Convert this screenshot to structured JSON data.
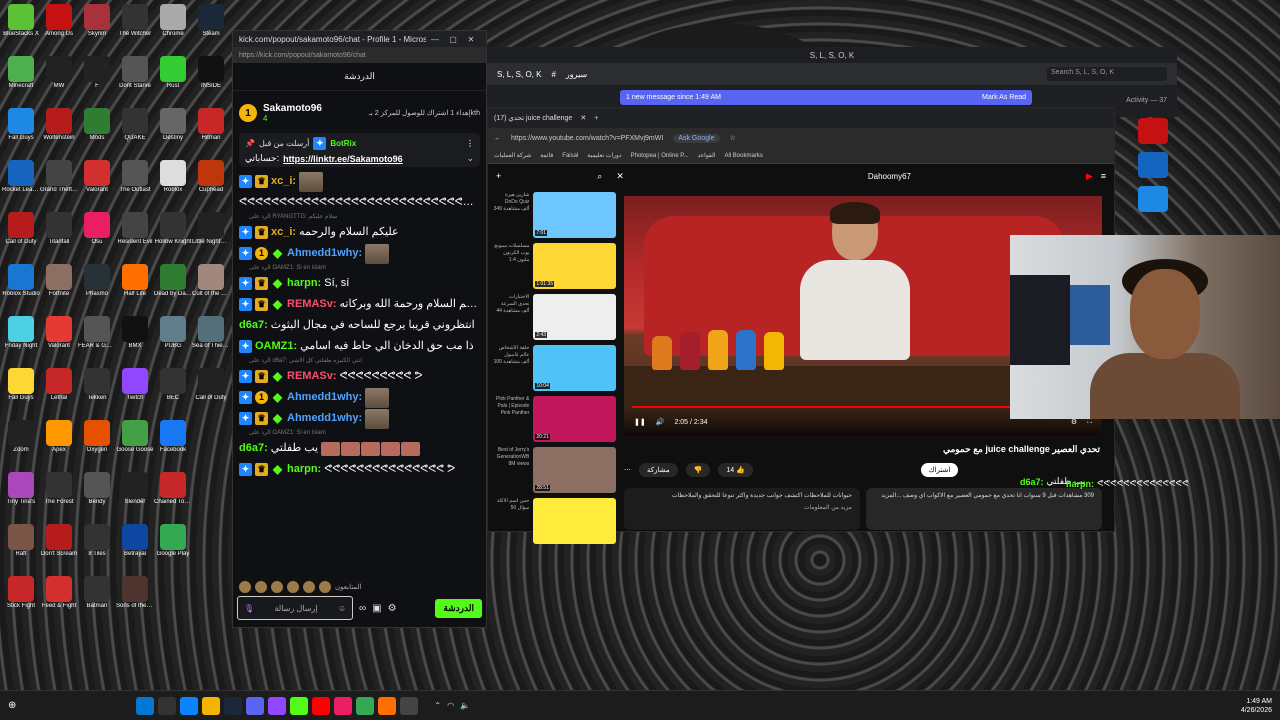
{
  "desktop": {
    "icons": [
      {
        "label": "BlueStacks X",
        "color": "#5bc236"
      },
      {
        "label": "Among Us",
        "color": "#c51111"
      },
      {
        "label": "Skyrim",
        "color": "#a8323c"
      },
      {
        "label": "The Witcher",
        "color": "#333"
      },
      {
        "label": "Chrome",
        "color": "#aaa"
      },
      {
        "label": "Steam",
        "color": "#1b2838"
      },
      {
        "label": "Minecraft",
        "color": "#4caf50"
      },
      {
        "label": "MW",
        "color": "#222"
      },
      {
        "label": "F",
        "color": "#222"
      },
      {
        "label": "Dont Starve",
        "color": "#555"
      },
      {
        "label": "Rust",
        "color": "#3c3"
      },
      {
        "label": "INSIDE",
        "color": "#111"
      },
      {
        "label": "Fall Guys",
        "color": "#1e88e5"
      },
      {
        "label": "Wolfenstein",
        "color": "#b71c1c"
      },
      {
        "label": "Mods",
        "color": "#2e7d32"
      },
      {
        "label": "QUAKE",
        "color": "#333"
      },
      {
        "label": "Destiny",
        "color": "#666"
      },
      {
        "label": "Hitman",
        "color": "#c62828"
      },
      {
        "label": "Rocket League",
        "color": "#1565c0"
      },
      {
        "label": "Grand Theft Auto",
        "color": "#444"
      },
      {
        "label": "Valorant",
        "color": "#d32f2f"
      },
      {
        "label": "The Outlast",
        "color": "#555"
      },
      {
        "label": "Roblox",
        "color": "#ddd"
      },
      {
        "label": "Cuphead",
        "color": "#bf360c"
      },
      {
        "label": "Call of Duty",
        "color": "#b71c1c"
      },
      {
        "label": "Titanfall",
        "color": "#333"
      },
      {
        "label": "Osu",
        "color": "#e91e63"
      },
      {
        "label": "Resident Evil",
        "color": "#444"
      },
      {
        "label": "Hollow Knight",
        "color": "#333"
      },
      {
        "label": "Little Nightmares",
        "color": "#222"
      },
      {
        "label": "Roblox Studio",
        "color": "#1976d2"
      },
      {
        "label": "Fortnite",
        "color": "#8d6e63"
      },
      {
        "label": "Phasmo",
        "color": "#263238"
      },
      {
        "label": "Half Life",
        "color": "#ff6f00"
      },
      {
        "label": "Dead by Daylight",
        "color": "#2e7d32"
      },
      {
        "label": "Cult of the Lamb",
        "color": "#a1887f"
      },
      {
        "label": "Friday Night",
        "color": "#4dd0e1"
      },
      {
        "label": "Valorant",
        "color": "#e53935"
      },
      {
        "label": "FEAR & GREED",
        "color": "#555"
      },
      {
        "label": "BMX",
        "color": "#111"
      },
      {
        "label": "PUBG",
        "color": "#607d8b"
      },
      {
        "label": "Sea of Thieves",
        "color": "#546e7a"
      },
      {
        "label": "Fall Guys",
        "color": "#fdd835"
      },
      {
        "label": "Lethal",
        "color": "#c62828"
      },
      {
        "label": "Tekken",
        "color": "#333"
      },
      {
        "label": "Twitch",
        "color": "#9146ff"
      },
      {
        "label": "BEC",
        "color": "#333"
      },
      {
        "label": "Call of Duty",
        "color": "#222"
      },
      {
        "label": "Zoom",
        "color": "#222"
      },
      {
        "label": "Apex",
        "color": "#ff9800"
      },
      {
        "label": "Oxygen",
        "color": "#e65100"
      },
      {
        "label": "Goose Goose",
        "color": "#43a047"
      },
      {
        "label": "Facebook",
        "color": "#1877f2"
      },
      {
        "label": "",
        "color": "transparent"
      },
      {
        "label": "Tiny Tina's",
        "color": "#ab47bc"
      },
      {
        "label": "The Forest",
        "color": "#333"
      },
      {
        "label": "Bendy",
        "color": "#555"
      },
      {
        "label": "Slender",
        "color": "#222"
      },
      {
        "label": "Chained Together",
        "color": "#c62828"
      },
      {
        "label": "",
        "color": "transparent"
      },
      {
        "label": "Raft",
        "color": "#795548"
      },
      {
        "label": "Don't Scream",
        "color": "#b71c1c"
      },
      {
        "label": "8 Tiles",
        "color": "#333"
      },
      {
        "label": "Betrayal",
        "color": "#0d47a1"
      },
      {
        "label": "Google Play",
        "color": "#34a853"
      },
      {
        "label": "",
        "color": "transparent"
      },
      {
        "label": "Stick Fight",
        "color": "#c62828"
      },
      {
        "label": "Feed & Fight",
        "color": "#d32f2f"
      },
      {
        "label": "Batman",
        "color": "#333"
      },
      {
        "label": "Sons of the Forest",
        "color": "#4e342e"
      },
      {
        "label": "",
        "color": "transparent"
      },
      {
        "label": "",
        "color": "transparent"
      }
    ]
  },
  "chat_window": {
    "title": "kick.com/popout/sakamoto96/chat - Profile 1 - Micros...",
    "url": "https://kick.com/popout/sakamoto96/chat",
    "header": "الدردشة",
    "pinned_user": "Sakamoto96",
    "pinned_medal": "1",
    "pinned_count": "4",
    "pinned_note": "إهداء 1 اشتراك للوصول للمركز 2 بـkth",
    "botrix": {
      "pre": "أرسلت من قبل",
      "name": "BotRix",
      "label": "حساباتي:",
      "link": "https://linktr.ee/Sakamoto96"
    },
    "messages": [
      {
        "reply": "",
        "user": "xc_i:",
        "color": "#e4ab22",
        "badges": [
          "pin",
          "crown"
        ],
        "text": ""
      },
      {
        "reply": "",
        "user": "",
        "color": "#fff",
        "badges": [],
        "text": "ᕙᕙᕙᕙᕙᕙᕙᕙᕙᕙᕙᕙᕙᕙᕙᕙᕙᕙᕙᕙᕙᕙᕙᕙᕙᕙᕙᕙᕙᕙᕙᕙᕙ ᕗ"
      },
      {
        "reply": "الرد على RYANGTTG: سلام عليكم",
        "user": "xc_i:",
        "color": "#e4ab22",
        "badges": [
          "pin",
          "crown"
        ],
        "text": "عليكم السلام والرحمه"
      },
      {
        "reply": "",
        "user": "Ahmedd1why:",
        "color": "#4fa3ff",
        "badges": [
          "pin",
          "one",
          "diamond"
        ],
        "text": ""
      },
      {
        "reply": "الرد على OAMZ1: Si en islam",
        "user": "harpn:",
        "color": "#53fc18",
        "badges": [
          "pin",
          "crown",
          "diamond"
        ],
        "text": "Sí, sí"
      },
      {
        "reply": "",
        "user": "REMASv:",
        "color": "#ff4d6d",
        "badges": [
          "pin",
          "crown",
          "diamond"
        ],
        "text": "وعليكم السلام ورحمة الله وبركاته"
      },
      {
        "reply": "",
        "user": "d6a7:",
        "color": "#53fc18",
        "badges": [],
        "text": "انتظروني قريبا يرجع للساحه في مجال البثوث"
      },
      {
        "reply": "",
        "user": "OAMZ1:",
        "color": "#53fc18",
        "badges": [
          "pin"
        ],
        "text": "ذا مب حق الدخان الي حاط فيه اسامي"
      },
      {
        "reply": "الرد على d6a7: انتي الكبيره طفلتي كل الاشي",
        "user": "REMASv:",
        "color": "#ff4d6d",
        "badges": [
          "pin",
          "crown",
          "diamond"
        ],
        "text": "ᕙᕙᕙᕙᕙᕙᕙᕙᕙ ᕗ"
      },
      {
        "reply": "",
        "user": "Ahmedd1why:",
        "color": "#4fa3ff",
        "badges": [
          "pin",
          "one",
          "diamond"
        ],
        "text": ""
      },
      {
        "reply": "",
        "user": "Ahmedd1why:",
        "color": "#4fa3ff",
        "badges": [
          "pin",
          "crown",
          "diamond"
        ],
        "text": ""
      },
      {
        "reply": "الرد على OAMZ1: Si en islam",
        "user": "d6a7:",
        "color": "#53fc18",
        "badges": [],
        "text": "يب طفلتي"
      },
      {
        "reply": "",
        "user": "harpn:",
        "color": "#53fc18",
        "badges": [
          "pin",
          "crown",
          "diamond"
        ],
        "text": "ᕙᕙᕙᕙᕙᕙᕙᕙᕙᕙᕙᕙᕙᕙᕙ ᕗ"
      }
    ],
    "emote_label": "المتابعون",
    "input_placeholder": "إرسال رسالة",
    "send_label": "الدردشة"
  },
  "discord": {
    "title": "S, L, S, O, K",
    "server": "S, L, S, O, K",
    "channel": "سيرور",
    "new_message": "1 new message since 1:49 AM",
    "mark_read": "Mark As Read",
    "search_placeholder": "Search S, L, S, O, K",
    "activity": "Activity — 37"
  },
  "youtube": {
    "tab_title": "تحدي (17) juice challenge",
    "url": "https://www.youtube.com/watch?v=PFXMvj9mWI",
    "ask": "Ask Google",
    "bookmarks": [
      "شركة العمليات",
      "قائمة",
      "Faisal",
      "دورات تعليمية",
      "Photopea | Online P...",
      "القواعد",
      "All Bookmarks"
    ],
    "channel_top": "Dahoomy67",
    "recs": [
      {
        "meta": "شارين هيرة\nDoDo Quiz\n349 ألف مشاهدة",
        "dur": "7:01",
        "color": "#6ec6ff"
      },
      {
        "meta": "مسلسلات سبونج\nبوب الكرتون\n1.4 مليون",
        "dur": "1:01:35",
        "color": "#fdd835"
      },
      {
        "meta": "الاختبارات\nتحدي السرعة\n44 ألف مشاهدة",
        "dur": "2:43",
        "color": "#eeeeee"
      },
      {
        "meta": "حلقة الأشخاص\nعالم غامبول\n100 ألف مشاهدة",
        "dur": "10:04",
        "color": "#4fc3f7"
      },
      {
        "meta": "Pink Panther &\nPals | Episode\nPink Panther",
        "dur": "20:21",
        "color": "#c2185b"
      },
      {
        "meta": "Best of Jerry's\nGenerationWB\n8M views",
        "dur": "28:51",
        "color": "#8d6e63"
      },
      {
        "meta": "خمن اسم الاكلة\n50 سؤال",
        "dur": "",
        "color": "#ffeb3b"
      }
    ],
    "time": "2:05 / 2:34",
    "progress": 0.88,
    "title": "تحدي العصير juice challenge مع حمومي",
    "subscribe": "اشتراك",
    "likes": "14",
    "share": "مشاركة",
    "desc": "309 مشاهدات قبل 9 سنوات\nانا تحدي مع حمومي العصير مع الاكواب اي وصف\n...المزيد",
    "notes": "حيوانات للملاحظات\nاكتشف جوانب جديدة واكثر تنوعا للتحقق والملاحظات",
    "notes_more": "مزيد من المعلومات"
  },
  "overlay": {
    "line1_user": "d6a7:",
    "line1_text": "يب طفلتي",
    "line2_user": "harpn:",
    "line2_text": "ᕙᕙᕙᕙᕙᕙᕙᕙᕙᕙᕙᕙᕙᕙ"
  },
  "taskbar": {
    "time": "1:49 AM",
    "date": "4/26/2026"
  }
}
